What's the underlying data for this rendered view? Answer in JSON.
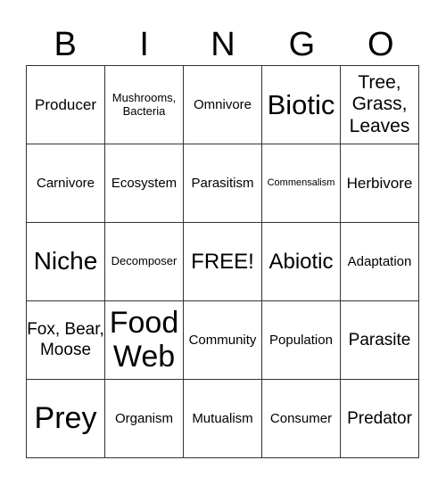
{
  "header": [
    "B",
    "I",
    "N",
    "G",
    "O"
  ],
  "rows": [
    [
      "Producer",
      "Mushrooms, Bacteria",
      "Omnivore",
      "Biotic",
      "Tree, Grass, Leaves"
    ],
    [
      "Carnivore",
      "Ecosystem",
      "Parasitism",
      "Commensalism",
      "Herbivore"
    ],
    [
      "Niche",
      "Decomposer",
      "FREE!",
      "Abiotic",
      "Adaptation"
    ],
    [
      "Fox, Bear, Moose",
      "Food Web",
      "Community",
      "Population",
      "Parasite"
    ],
    [
      "Prey",
      "Organism",
      "Mutualism",
      "Consumer",
      "Predator"
    ]
  ]
}
